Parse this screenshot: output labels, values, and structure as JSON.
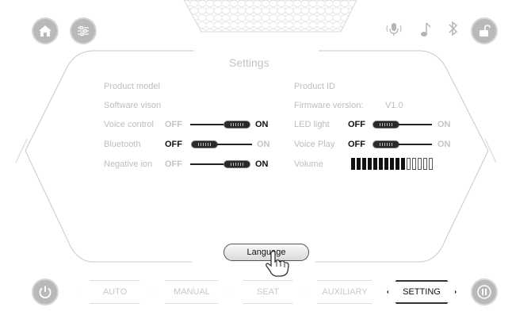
{
  "title": "Settings",
  "left_rows": [
    {
      "label": "Product model"
    },
    {
      "label": "Software vison"
    },
    {
      "label": "Voice control",
      "off": "OFF",
      "on": "ON",
      "state": "on"
    },
    {
      "label": "Bluetooth",
      "off": "OFF",
      "on": "ON",
      "state": "off"
    },
    {
      "label": "Negative ion",
      "off": "OFF",
      "on": "ON",
      "state": "on"
    }
  ],
  "right_rows": [
    {
      "label": "Product ID"
    },
    {
      "label": "Firmware version:",
      "value": "V1.0"
    },
    {
      "label": "LED  light",
      "off": "OFF",
      "on": "ON",
      "state": "off"
    },
    {
      "label": "Voice Play",
      "off": "OFF",
      "on": "ON",
      "state": "off"
    },
    {
      "label": "Volume",
      "level": 10,
      "max": 15
    }
  ],
  "language_button": "Language",
  "tabs": [
    "AUTO",
    "MANUAL",
    "SEAT",
    "AUXILIARY",
    "SETTING"
  ],
  "active_tab": "SETTING",
  "icons": {
    "top_left": [
      "home-icon",
      "sliders-icon"
    ],
    "top_right": [
      "microphone-icon",
      "music-note-icon",
      "bluetooth-icon",
      "unlock-icon"
    ],
    "bottom": [
      "power-icon",
      "pause-icon"
    ]
  },
  "colors": {
    "button_grey": "#b9b9b9",
    "label_grey": "#bdbdbd",
    "active": "#111111"
  }
}
